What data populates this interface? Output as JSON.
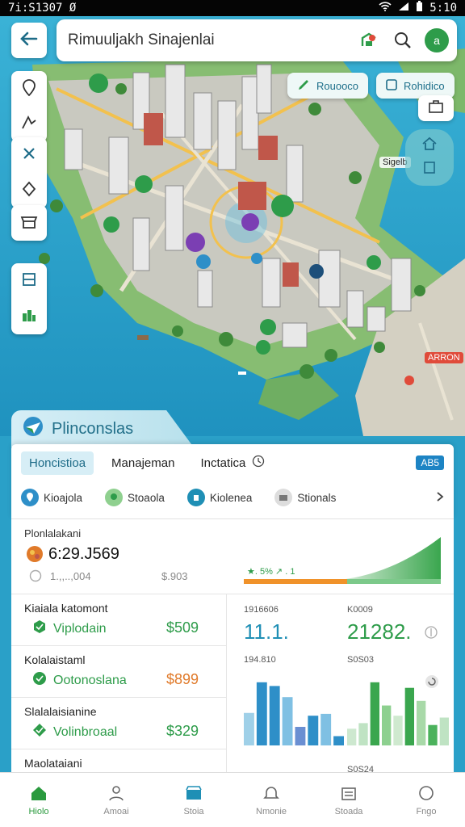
{
  "status_bar": {
    "time_left": "7i:S1307",
    "time_right": "5:10",
    "left_glyph": "Ø"
  },
  "search": {
    "query": "Rimuuljakh Sinajenlai"
  },
  "map": {
    "chips": {
      "left": "Rouooco",
      "right": "Rohidico"
    },
    "labels": [
      "Sigelb",
      "ARRON"
    ],
    "accent_water": "#2aa0c8",
    "accent_land": "#7db86a"
  },
  "panel": {
    "title": "Plinconslas",
    "tabs": [
      "Honcistioa",
      "Manajeman",
      "Inctatica"
    ],
    "tab_badge": "AB5",
    "categories": [
      "Kioajola",
      "Stoaola",
      "Kiolenea",
      "Stionals"
    ]
  },
  "summary": {
    "title": "Plonlalakani",
    "value": "6:29.J569",
    "sub_left": "1.,,..,004",
    "sub_right": "$.903",
    "chart_label": "★. 5% ↗ . 1"
  },
  "list": [
    {
      "title": "Kiaiala katomont",
      "name": "Viplodain",
      "amount": "$509",
      "color": "#2e9c4a"
    },
    {
      "title": "Kolalaistaml",
      "name": "Ootonoslana",
      "amount": "$899",
      "color": "#e07a2a"
    },
    {
      "title": "Slalalaisianine",
      "name": "Volinbroaal",
      "amount": "$329",
      "color": "#2e9c4a"
    },
    {
      "title": "Maolataiani",
      "name": "",
      "amount": "",
      "color": "#2e9c4a"
    }
  ],
  "stats": {
    "left": {
      "label": "1916606",
      "value": "11.1.",
      "sub": "194.810"
    },
    "right": {
      "label": "K0009",
      "value": "21282.",
      "sub": "S0S03"
    },
    "bottom_label": "S0S24"
  },
  "chart_data": [
    {
      "type": "bar",
      "title": "",
      "categories": [
        "1",
        "2",
        "3",
        "4",
        "5",
        "6",
        "7",
        "8"
      ],
      "values": [
        3.5,
        6.8,
        6.4,
        5.2,
        2.0,
        3.2,
        3.4,
        1.0
      ],
      "colors": [
        "#9fd0e8",
        "#2e8fc8",
        "#2e8fc8",
        "#7fc0e3",
        "#6a8fd2",
        "#2e8fc8",
        "#7fc0e3",
        "#2e8fc8"
      ],
      "ylim": [
        0,
        8
      ]
    },
    {
      "type": "bar",
      "title": "",
      "categories": [
        "1",
        "2",
        "3",
        "4",
        "5",
        "6",
        "7",
        "8",
        "9"
      ],
      "values": [
        1.8,
        2.4,
        6.8,
        4.3,
        3.2,
        6.2,
        4.8,
        2.2,
        3.0
      ],
      "colors": [
        "#cde8cf",
        "#bfe3c3",
        "#3aa64e",
        "#8dd08f",
        "#cfe9cf",
        "#3aa64e",
        "#a8d9a8",
        "#4bb25c",
        "#bfe3c3"
      ],
      "ylim": [
        0,
        8
      ]
    }
  ],
  "nav": [
    "Hiolo",
    "Amoai",
    "Stoia",
    "Nmonie",
    "Stoada",
    "Fngo"
  ]
}
